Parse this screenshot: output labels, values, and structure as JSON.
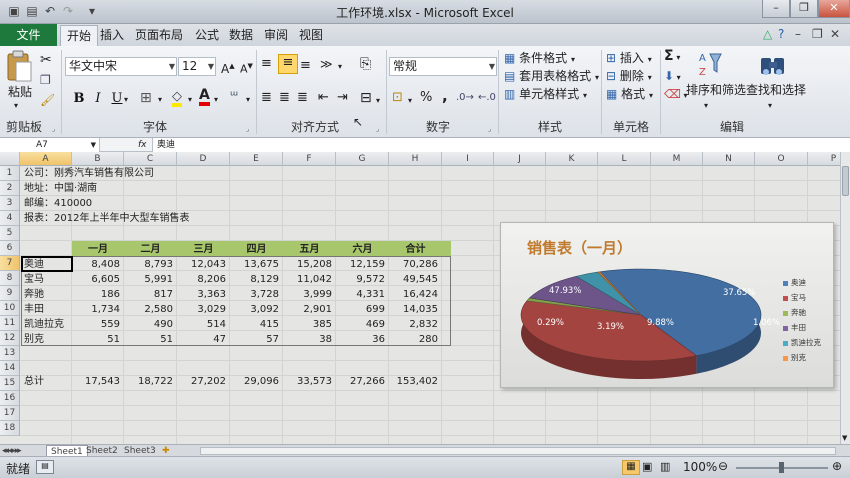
{
  "window": {
    "title": "工作环境.xlsx - Microsoft Excel"
  },
  "tabs": {
    "file": "文件",
    "items": [
      "开始",
      "插入",
      "页面布局",
      "公式",
      "数据",
      "审阅",
      "视图"
    ]
  },
  "ribbon": {
    "clipboard": {
      "paste": "粘贴",
      "label": "剪贴板"
    },
    "font": {
      "name": "华文中宋",
      "size": "12",
      "label": "字体",
      "bold": "B",
      "italic": "I",
      "underline": "U",
      "grow": "A",
      "shrink": "A",
      "color_letter": "A"
    },
    "alignment": {
      "label": "对齐方式"
    },
    "number": {
      "format": "常规",
      "label": "数字",
      "percent": "%",
      "comma": ","
    },
    "styles": {
      "conditional": "条件格式",
      "table": "套用表格格式",
      "cell": "单元格样式",
      "label": "样式"
    },
    "cells": {
      "insert": "插入",
      "delete": "删除",
      "format": "格式",
      "label": "单元格"
    },
    "editing": {
      "sigma": "Σ",
      "sort": "排序和筛选",
      "find": "查找和选择",
      "label": "编辑"
    }
  },
  "formula_bar": {
    "name_box": "A7",
    "fx": "fx",
    "content": "奥迪"
  },
  "columns": [
    "A",
    "B",
    "C",
    "D",
    "E",
    "F",
    "G",
    "H",
    "I",
    "J",
    "K",
    "L",
    "M",
    "N",
    "O",
    "P"
  ],
  "rows": [
    "1",
    "2",
    "3",
    "4",
    "5",
    "6",
    "7",
    "8",
    "9",
    "10",
    "11",
    "12",
    "13",
    "14",
    "15",
    "16",
    "17",
    "18"
  ],
  "info": [
    "公司：刚秀汽车销售有限公司",
    "地址：中国·湖南",
    "邮编：410000",
    "报表：2012年上半年中大型车销售表"
  ],
  "table": {
    "headers": [
      "一月",
      "二月",
      "三月",
      "四月",
      "五月",
      "六月",
      "合计"
    ],
    "rows": [
      {
        "name": "奥迪",
        "values": [
          "8,408",
          "8,793",
          "12,043",
          "13,675",
          "15,208",
          "12,159",
          "70,286"
        ]
      },
      {
        "name": "宝马",
        "values": [
          "6,605",
          "5,991",
          "8,206",
          "8,129",
          "11,042",
          "9,572",
          "49,545"
        ]
      },
      {
        "name": "奔驰",
        "values": [
          "186",
          "817",
          "3,363",
          "3,728",
          "3,999",
          "4,331",
          "16,424"
        ]
      },
      {
        "name": "丰田",
        "values": [
          "1,734",
          "2,580",
          "3,029",
          "3,092",
          "2,901",
          "699",
          "14,035"
        ]
      },
      {
        "name": "凯迪拉克",
        "values": [
          "559",
          "490",
          "514",
          "415",
          "385",
          "469",
          "2,832"
        ]
      },
      {
        "name": "别克",
        "values": [
          "51",
          "51",
          "47",
          "57",
          "38",
          "36",
          "280"
        ]
      }
    ],
    "total": {
      "name": "总计",
      "values": [
        "17,543",
        "18,722",
        "27,202",
        "29,096",
        "33,573",
        "27,266",
        "153,402"
      ]
    }
  },
  "chart_data": {
    "type": "pie",
    "title": "销售表（一月）",
    "labels": [
      "奥迪",
      "宝马",
      "奔驰",
      "丰田",
      "凯迪拉克",
      "别克"
    ],
    "values": [
      47.93,
      37.65,
      1.06,
      9.88,
      3.19,
      0.29
    ],
    "value_labels": [
      "47.93%",
      "37.65%",
      "1.06%",
      "9.88%",
      "3.19%",
      "0.29%"
    ],
    "colors": [
      "#4f81bd",
      "#c0504d",
      "#9bbb59",
      "#8064a2",
      "#4bacc6",
      "#f79646"
    ],
    "legend": "right"
  },
  "sheets": [
    "Sheet1",
    "Sheet2",
    "Sheet3"
  ],
  "status": {
    "ready": "就绪",
    "zoom": "100%"
  }
}
